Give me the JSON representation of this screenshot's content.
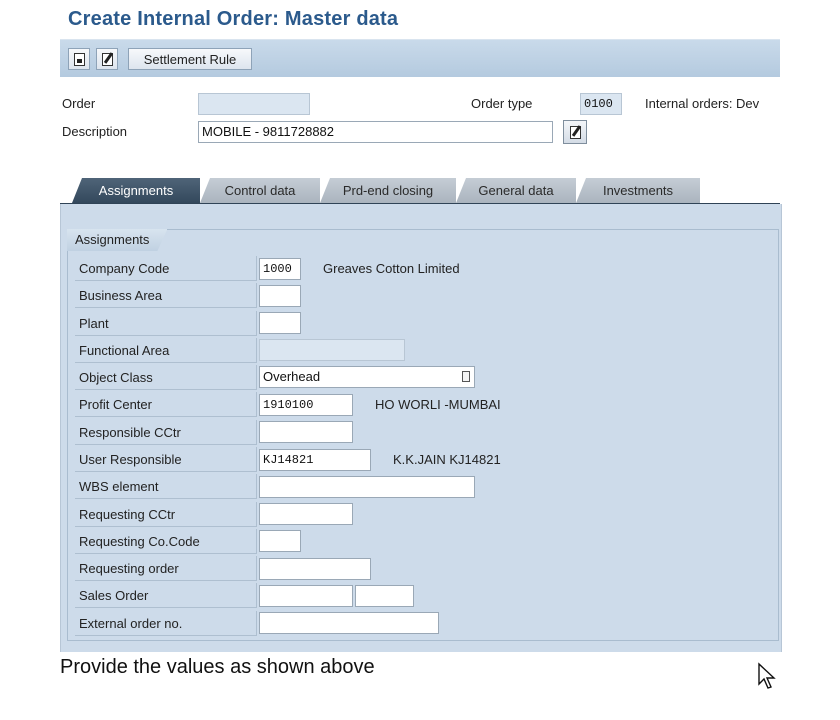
{
  "window": {
    "title": "Create Internal Order: Master data"
  },
  "toolbar": {
    "icons": [
      "save-doc-icon",
      "edit-doc-icon"
    ],
    "settlement_rule_label": "Settlement Rule"
  },
  "header": {
    "order_label": "Order",
    "order_value": "",
    "order_type_label": "Order type",
    "order_type_value": "0100",
    "order_type_desc": "Internal orders: Dev",
    "description_label": "Description",
    "description_value": "MOBILE - 9811728882"
  },
  "tabs": [
    {
      "label": "Assignments",
      "active": true
    },
    {
      "label": "Control data",
      "active": false
    },
    {
      "label": "Prd-end closing",
      "active": false
    },
    {
      "label": "General data",
      "active": false
    },
    {
      "label": "Investments",
      "active": false
    }
  ],
  "assignments": {
    "group_title": "Assignments",
    "rows": [
      {
        "label": "Company Code",
        "value": "1000",
        "desc": "Greaves Cotton Limited"
      },
      {
        "label": "Business Area",
        "value": "",
        "desc": ""
      },
      {
        "label": "Plant",
        "value": "",
        "desc": ""
      },
      {
        "label": "Functional Area",
        "value": "",
        "desc": ""
      },
      {
        "label": "Object Class",
        "value": "Overhead",
        "desc": ""
      },
      {
        "label": "Profit Center",
        "value": "1910100",
        "desc": "HO WORLI -MUMBAI"
      },
      {
        "label": "Responsible CCtr",
        "value": "",
        "desc": ""
      },
      {
        "label": "User Responsible",
        "value": "KJ14821",
        "desc": "K.K.JAIN KJ14821"
      },
      {
        "label": "WBS element",
        "value": "",
        "desc": ""
      },
      {
        "label": "Requesting CCtr",
        "value": "",
        "desc": ""
      },
      {
        "label": "Requesting Co.Code",
        "value": "",
        "desc": ""
      },
      {
        "label": "Requesting order",
        "value": "",
        "desc": ""
      },
      {
        "label": "Sales Order",
        "value": "",
        "value2": "",
        "desc": ""
      },
      {
        "label": "External order no.",
        "value": "",
        "desc": ""
      }
    ]
  },
  "caption": "Provide the values as shown above",
  "colors": {
    "title": "#2b5a8c",
    "toolbar": "#b4cadf",
    "panel": "#cddbea",
    "active_tab": "#33485c"
  }
}
